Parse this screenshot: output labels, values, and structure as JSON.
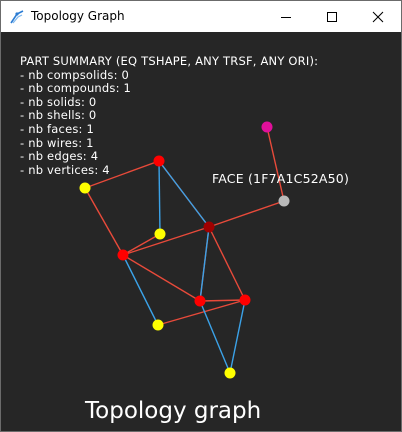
{
  "window": {
    "title": "Topology Graph",
    "controls": [
      "minimize",
      "maximize",
      "close"
    ]
  },
  "summary": {
    "heading": "PART SUMMARY (EQ TSHAPE, ANY TRSF, ANY ORI):",
    "lines": [
      "- nb compsolids: 0",
      "- nb compounds: 1",
      "- nb solids: 0",
      "- nb shells: 0",
      "- nb faces: 1",
      "- nb wires: 1",
      "- nb edges: 4",
      "- nb vertices: 4"
    ]
  },
  "graph": {
    "selected_label": "FACE (1F7A1C52A50)",
    "footer_title": "Topology graph",
    "colors": {
      "background": "#262626",
      "compound_node": "#e0109a",
      "face_node": "#b9b9b9",
      "wire_node": "#a00000",
      "edge_node": "#ff0000",
      "vertex_node": "#ffff00",
      "red_link": "#e84a3a",
      "blue_link": "#3ba2e8"
    },
    "node_types": [
      "compound",
      "face",
      "wire",
      "edge",
      "edge",
      "edge",
      "edge",
      "vertex",
      "vertex",
      "vertex",
      "vertex"
    ]
  }
}
